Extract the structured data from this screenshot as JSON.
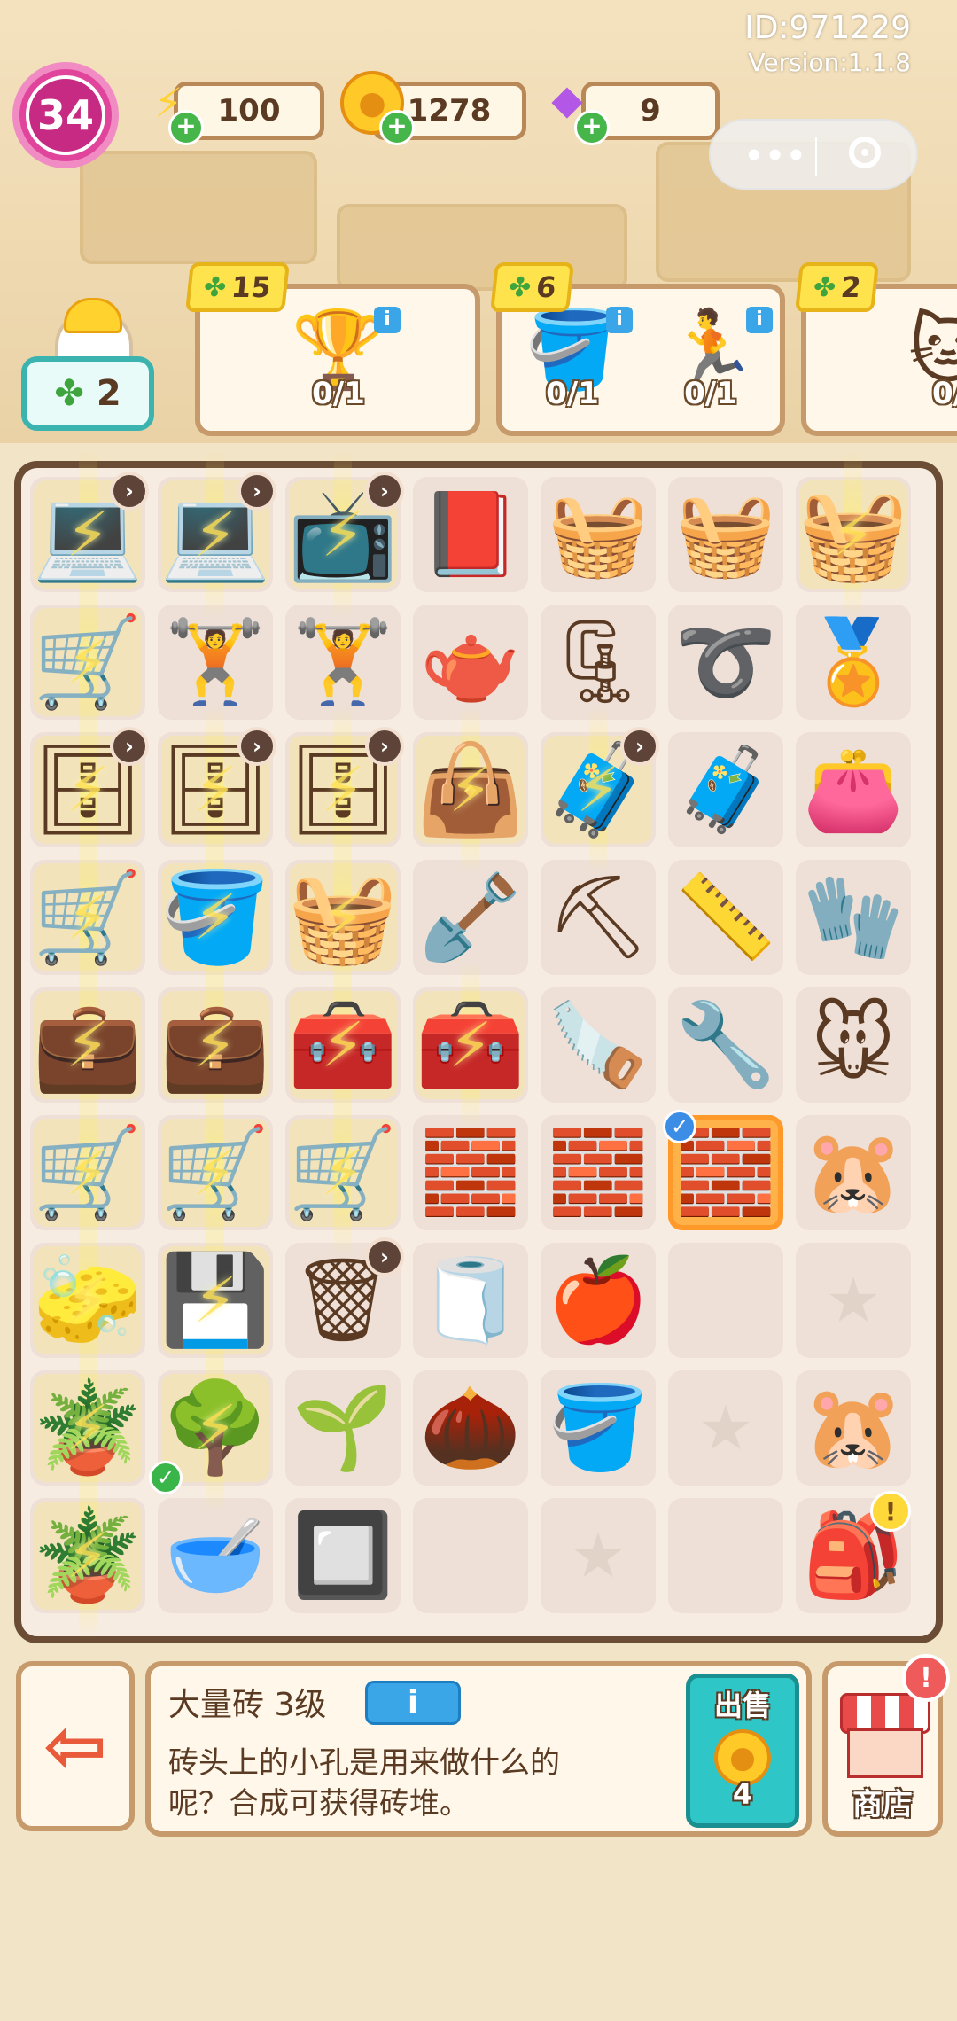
{
  "header": {
    "player_id": "ID:971229",
    "version": "Version:1.1.8",
    "level": "34"
  },
  "resources": {
    "energy": {
      "value": "100",
      "icon": "lightning-icon",
      "color": "#ffd23a"
    },
    "coins": {
      "value": "1278",
      "icon": "coin-icon",
      "color": "#ffc928"
    },
    "gems": {
      "value": "9",
      "icon": "gem-icon",
      "color": "#b257e6"
    }
  },
  "mascot": {
    "value": "2"
  },
  "orders": [
    {
      "reward": "15",
      "items": [
        {
          "name": "trophy",
          "glyph": "🏆",
          "progress": "0/1"
        }
      ]
    },
    {
      "reward": "6",
      "items": [
        {
          "name": "paint-bucket",
          "glyph": "🪣",
          "progress": "0/1"
        },
        {
          "name": "treadmill",
          "glyph": "🏃",
          "progress": "0/1"
        }
      ]
    },
    {
      "reward": "2",
      "items": [
        {
          "name": "cat",
          "glyph": "🐱",
          "progress": "0/"
        }
      ]
    }
  ],
  "board": {
    "rows": [
      [
        {
          "name": "laptop",
          "glyph": "💻",
          "gen": true,
          "timer": true
        },
        {
          "name": "laptop",
          "glyph": "💻",
          "gen": true,
          "timer": true
        },
        {
          "name": "tv-robot",
          "glyph": "📺",
          "gen": true,
          "timer": true
        },
        {
          "name": "book",
          "glyph": "📕"
        },
        {
          "name": "basket-small",
          "glyph": "🧺"
        },
        {
          "name": "basket",
          "glyph": "🧺"
        },
        {
          "name": "basket",
          "glyph": "🧺",
          "gen": true
        }
      ],
      [
        {
          "name": "toy-cart",
          "glyph": "🛒",
          "gen": true
        },
        {
          "name": "dumbbell",
          "glyph": "🏋"
        },
        {
          "name": "dumbbell",
          "glyph": "🏋"
        },
        {
          "name": "kettlebell",
          "glyph": "🫖"
        },
        {
          "name": "hand-grip",
          "glyph": "🗜"
        },
        {
          "name": "jump-rope",
          "glyph": "➰"
        },
        {
          "name": "medal",
          "glyph": "🏅"
        }
      ],
      [
        {
          "name": "cabinet",
          "glyph": "🗄",
          "gen": true,
          "timer": true
        },
        {
          "name": "cabinet",
          "glyph": "🗄",
          "gen": true,
          "timer": true
        },
        {
          "name": "cabinet",
          "glyph": "🗄",
          "gen": true,
          "timer": true
        },
        {
          "name": "clothes-pile",
          "glyph": "👜",
          "gen": true
        },
        {
          "name": "clothes-box",
          "glyph": "🧳",
          "gen": true,
          "timer": true
        },
        {
          "name": "clothes-box",
          "glyph": "🧳"
        },
        {
          "name": "wallet",
          "glyph": "👛"
        }
      ],
      [
        {
          "name": "wheelbarrow",
          "glyph": "🛒",
          "gen": true
        },
        {
          "name": "tool-bucket",
          "glyph": "🪣",
          "gen": true
        },
        {
          "name": "tool-basket",
          "glyph": "🧺",
          "gen": true
        },
        {
          "name": "shovel",
          "glyph": "🪏"
        },
        {
          "name": "pickaxe",
          "glyph": "⛏"
        },
        {
          "name": "tape-measure",
          "glyph": "📏"
        },
        {
          "name": "glove",
          "glyph": "🧤"
        }
      ],
      [
        {
          "name": "green-case",
          "glyph": "💼",
          "gen": true
        },
        {
          "name": "green-case",
          "glyph": "💼",
          "gen": true
        },
        {
          "name": "toolbox",
          "glyph": "🧰",
          "gen": true
        },
        {
          "name": "toolbox",
          "glyph": "🧰",
          "gen": true
        },
        {
          "name": "hacksaw",
          "glyph": "🪚"
        },
        {
          "name": "pliers",
          "glyph": "🔧"
        },
        {
          "name": "hamster",
          "glyph": "🐭"
        }
      ],
      [
        {
          "name": "shopping-cart",
          "glyph": "🛒",
          "gen": true
        },
        {
          "name": "shopping-cart",
          "glyph": "🛒",
          "gen": true
        },
        {
          "name": "shopping-cart",
          "glyph": "🛒",
          "gen": true
        },
        {
          "name": "brick-pallet",
          "glyph": "🧱"
        },
        {
          "name": "brick",
          "glyph": "🧱"
        },
        {
          "name": "bricks",
          "glyph": "🧱",
          "selected": true,
          "checkmark": "blue"
        },
        {
          "name": "hamster-group",
          "glyph": "🐹"
        }
      ],
      [
        {
          "name": "cleaner",
          "glyph": "🧽",
          "gen": true
        },
        {
          "name": "cpu-board",
          "glyph": "💾",
          "gen": true
        },
        {
          "name": "garbage-bag",
          "glyph": "🗑",
          "timer": true
        },
        {
          "name": "paper-roll",
          "glyph": "🧻"
        },
        {
          "name": "apple-core",
          "glyph": "🍎"
        },
        {
          "name": "empty",
          "glyph": ""
        },
        {
          "name": "locked",
          "glyph": "★",
          "star": true
        }
      ],
      [
        {
          "name": "plant-pot",
          "glyph": "🪴",
          "gen": true
        },
        {
          "name": "small-tree",
          "glyph": "🌳",
          "gen": true,
          "checkmark": "green"
        },
        {
          "name": "sprout",
          "glyph": "🌱"
        },
        {
          "name": "seed-packet",
          "glyph": "🌰"
        },
        {
          "name": "paint-bucket",
          "glyph": "🪣"
        },
        {
          "name": "locked",
          "glyph": "★",
          "star": true
        },
        {
          "name": "hamster",
          "glyph": "🐹"
        }
      ],
      [
        {
          "name": "flower-pot",
          "glyph": "🪴",
          "gen": true
        },
        {
          "name": "mortar",
          "glyph": "🥣"
        },
        {
          "name": "cpu-chip",
          "glyph": "🔲"
        },
        {
          "name": "empty",
          "glyph": ""
        },
        {
          "name": "locked",
          "glyph": "★",
          "star": true
        },
        {
          "name": "empty",
          "glyph": ""
        },
        {
          "name": "backpack",
          "glyph": "🎒",
          "alert": true
        }
      ]
    ]
  },
  "info_panel": {
    "item_name": "大量砖 3级",
    "info_button": "i",
    "description_line1": "砖头上的小孔是用来做什么的",
    "description_line2": "呢？合成可获得砖堆。",
    "sell_label": "出售",
    "sell_price": "4"
  },
  "shop": {
    "label": "商店",
    "alert": "!"
  },
  "exit_icon": "exit-icon"
}
